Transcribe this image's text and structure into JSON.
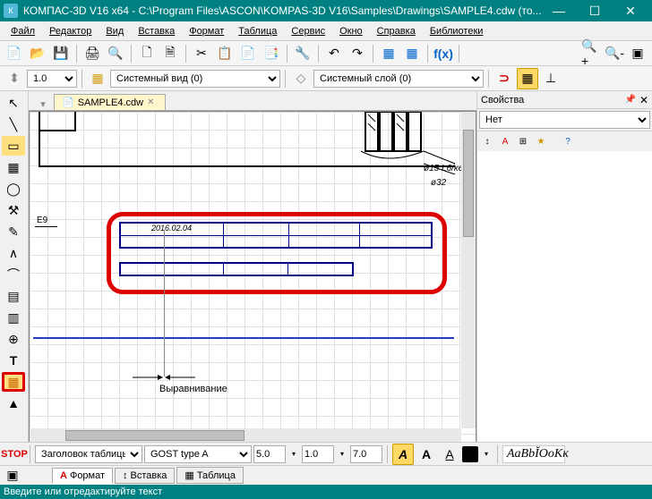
{
  "titlebar": {
    "icon_label": "К",
    "title": "КОМПАС-3D V16  x64 - C:\\Program Files\\ASCON\\KOMPAS-3D V16\\Samples\\Drawings\\SAMPLE4.cdw (то..."
  },
  "menus": [
    "Файл",
    "Редактор",
    "Вид",
    "Вставка",
    "Формат",
    "Таблица",
    "Сервис",
    "Окно",
    "Справка",
    "Библиотеки"
  ],
  "toolbar2": {
    "scale": "1.0",
    "view": "Системный вид (0)",
    "layer": "Системный слой (0)"
  },
  "tab": {
    "name": "SAMPLE4.cdw"
  },
  "properties": {
    "title": "Свойства",
    "empty": "Нет"
  },
  "canvas": {
    "date_cell": "2016.02.04",
    "e9_label": "E9",
    "align_label": "Выравнивание",
    "dim1": "ø15 L6/ке",
    "dim2": "ø32"
  },
  "propbar": {
    "header_select": "Заголовок таблицы",
    "font_select": "GOST type A",
    "size1": "5.0",
    "size2": "1.0",
    "size3": "7.0",
    "style_preview": "AaBbĬOoKк",
    "tabs": [
      "Формат",
      "Вставка",
      "Таблица"
    ]
  },
  "status": "Введите или отредактируйте текст"
}
